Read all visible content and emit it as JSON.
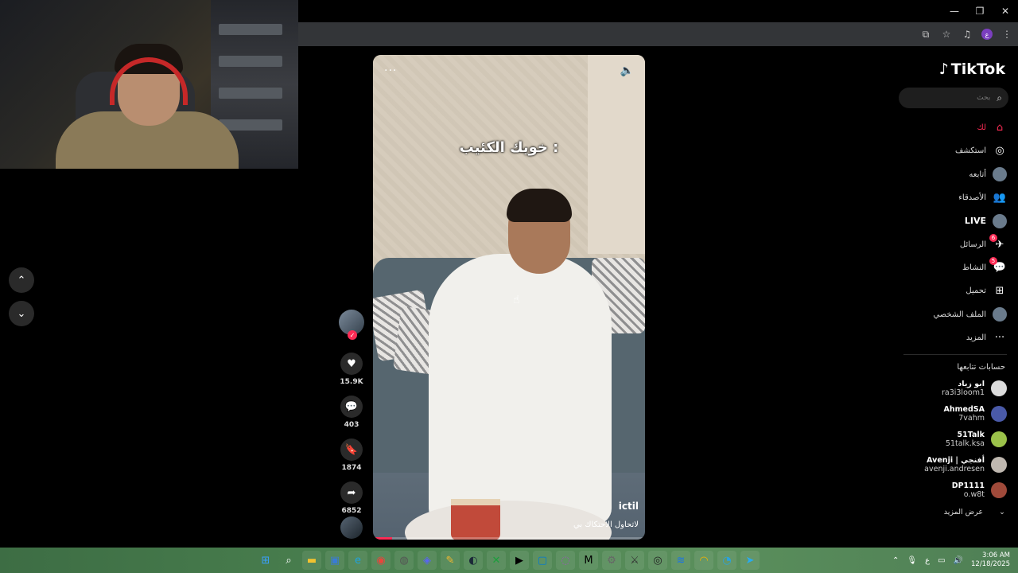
{
  "window": {
    "controls": [
      "—",
      "❐",
      "✕"
    ]
  },
  "browser": {
    "toolbar_icons": [
      "cast-icon",
      "star-icon",
      "media-icon",
      "profile-icon",
      "menu-icon"
    ],
    "profile_initial": "ع"
  },
  "feed": {
    "prev_label": "⌃",
    "next_label": "⌄"
  },
  "video": {
    "caption": "خويك الكئيب :",
    "author": "ictil",
    "description": "لاتحاول الاحتكاك بي",
    "more_label": "···",
    "volume_label": "🔈",
    "progress": 0.07
  },
  "actions": {
    "likes": "15.9K",
    "comments": "403",
    "saves": "1874",
    "shares": "6852"
  },
  "sidebar": {
    "logo": "TikTok",
    "search_placeholder": "بحث",
    "nav": [
      {
        "label": "لك",
        "icon": "home-icon",
        "glyph": "⌂",
        "active": true
      },
      {
        "label": "استكشف",
        "icon": "compass-icon",
        "glyph": "◎"
      },
      {
        "label": "أتابعه",
        "icon": "following-avatar-icon",
        "glyph": ""
      },
      {
        "label": "الأصدقاء",
        "icon": "friends-icon",
        "glyph": "👥"
      },
      {
        "label": "LIVE",
        "icon": "live-icon",
        "glyph": ""
      },
      {
        "label": "الرسائل",
        "icon": "messages-icon",
        "glyph": "✈",
        "badge": "6"
      },
      {
        "label": "النشاط",
        "icon": "activity-icon",
        "glyph": "💬",
        "badge": "5"
      },
      {
        "label": "تحميل",
        "icon": "upload-icon",
        "glyph": "⊞"
      },
      {
        "label": "الملف الشخصي",
        "icon": "profile-icon",
        "glyph": ""
      },
      {
        "label": "المزيد",
        "icon": "more-icon",
        "glyph": "···"
      }
    ],
    "following_title": "حسابات تتابعها",
    "accounts": [
      {
        "name": "ابو زياد",
        "username": "ra3i3loom1"
      },
      {
        "name": "AhmedSA",
        "username": "7vahm"
      },
      {
        "name": "51Talk",
        "username": "51talk.ksa"
      },
      {
        "name": "Avenji | أفنجي",
        "username": "avenji.andresen"
      },
      {
        "name": "DP1111",
        "username": "o.w8t"
      }
    ],
    "see_more": "عرض المزيد",
    "see_more_icon": "⌄"
  },
  "taskbar": {
    "apps": [
      "start-icon",
      "search-icon",
      "file-explorer-icon",
      "store-icon",
      "edge-icon",
      "chrome-icon",
      "steam-tool-icon",
      "discord-icon",
      "app-icon",
      "steam-icon",
      "xbox-icon",
      "capcut-icon",
      "app2-icon",
      "app3-icon",
      "medium-icon",
      "tool-icon",
      "game-icon",
      "obs-icon",
      "app4-icon",
      "app5-icon",
      "app6-icon",
      "telegram-icon"
    ],
    "tray_lang": "ع",
    "time": "3:06 AM",
    "date": "12/18/2025"
  }
}
